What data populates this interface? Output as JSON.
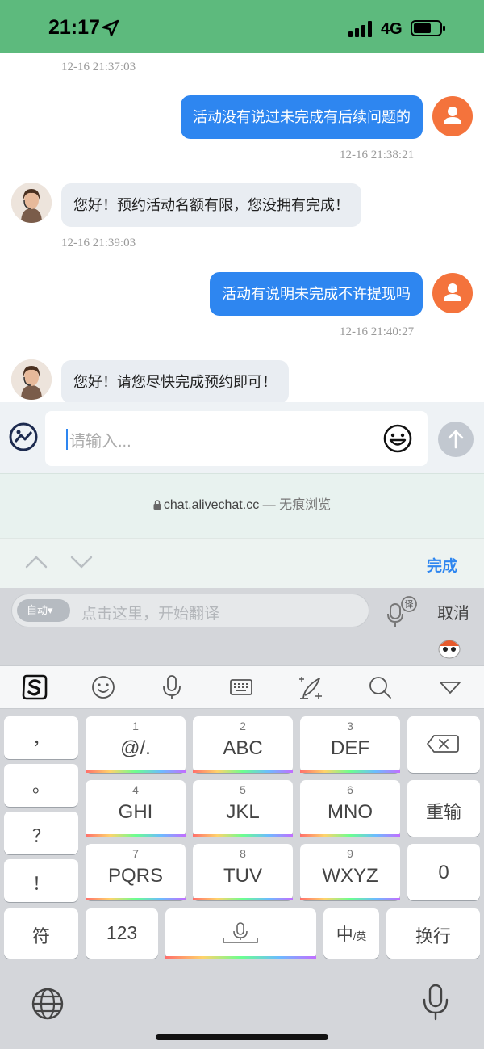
{
  "status_bar": {
    "time": "21:17",
    "network": "4G"
  },
  "chat": {
    "messages": [
      {
        "type": "timestamp",
        "text": "12-16 21:37:03"
      },
      {
        "type": "outgoing",
        "text": "活动没有说过未完成有后续问题的",
        "time": "12-16 21:38:21"
      },
      {
        "type": "incoming",
        "text": "您好！预约活动名额有限，您没拥有完成！",
        "time": "12-16 21:39:03"
      },
      {
        "type": "outgoing",
        "text": "活动有说明未完成不许提现吗",
        "time": "12-16 21:40:27"
      },
      {
        "type": "incoming",
        "text": "您好！请您尽快完成预约即可！"
      }
    ]
  },
  "input": {
    "placeholder": "请输入..."
  },
  "url_bar": {
    "domain": "chat.alivechat.cc",
    "mode": " — 无痕浏览"
  },
  "accessory": {
    "done_label": "完成"
  },
  "keyboard": {
    "translate": {
      "auto_label": "自动▾",
      "placeholder": "点击这里，开始翻译",
      "cancel_label": "取消"
    },
    "toolbar_icons": [
      "sogou-logo-icon",
      "emoji-icon",
      "microphone-icon",
      "keyboard-icon",
      "handwriting-icon",
      "search-icon",
      "collapse-icon"
    ],
    "punctuation": [
      "，",
      "。",
      "？",
      "！"
    ],
    "keys": [
      {
        "num": "1",
        "letters": "@/."
      },
      {
        "num": "2",
        "letters": "ABC"
      },
      {
        "num": "3",
        "letters": "DEF"
      },
      {
        "num": "4",
        "letters": "GHI"
      },
      {
        "num": "5",
        "letters": "JKL"
      },
      {
        "num": "6",
        "letters": "MNO"
      },
      {
        "num": "7",
        "letters": "PQRS"
      },
      {
        "num": "8",
        "letters": "TUV"
      },
      {
        "num": "9",
        "letters": "WXYZ"
      }
    ],
    "reenter_label": "重输",
    "zero_label": "0",
    "symbol_label": "符",
    "num_label": "123",
    "lang_main": "中",
    "lang_sub": "/英",
    "newline_label": "换行"
  }
}
